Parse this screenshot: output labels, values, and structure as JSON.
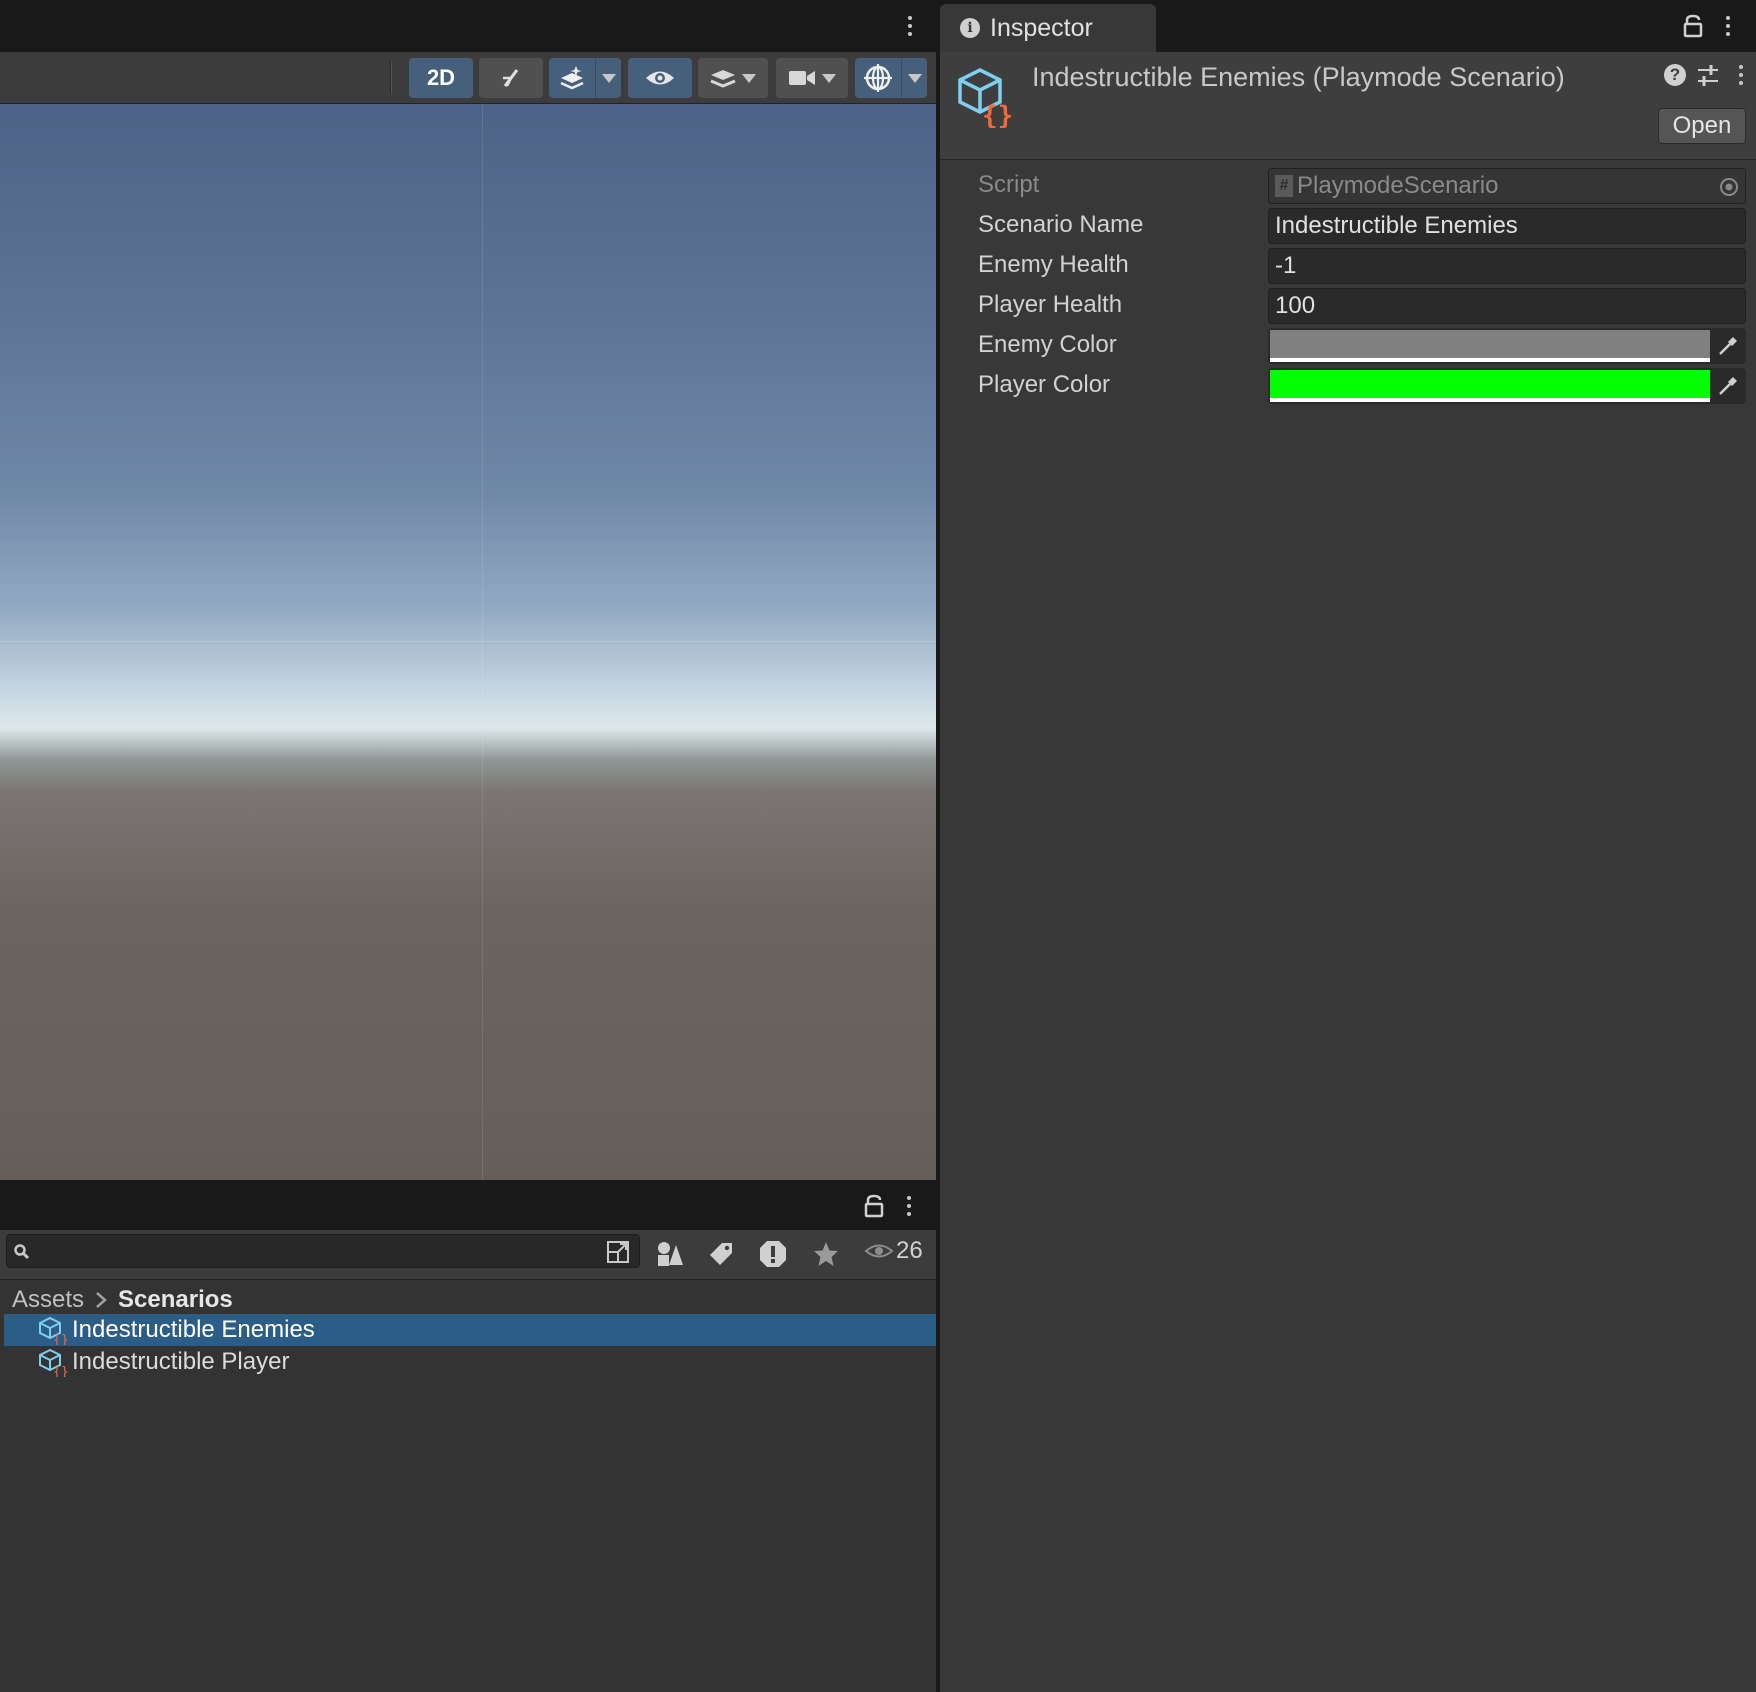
{
  "scene": {
    "toolbar": {
      "mode_2d_label": "2D",
      "icons": [
        "lighting-off-icon",
        "fx-layers-icon",
        "visibility-eye-icon",
        "layers-icon",
        "camera-icon",
        "gizmos-globe-icon"
      ]
    },
    "sky_color": "#5d7496",
    "ground_color": "#665e5a"
  },
  "project": {
    "search": {
      "placeholder": "",
      "value": ""
    },
    "hidden_count": "26",
    "breadcrumb": {
      "root": "Assets",
      "separator": ">",
      "current": "Scenarios"
    },
    "assets": [
      {
        "name": "Indestructible Enemies",
        "selected": true
      },
      {
        "name": "Indestructible Player",
        "selected": false
      }
    ],
    "selection_color": "#2c5d87"
  },
  "inspector": {
    "tab_label": "Inspector",
    "title": "Indestructible Enemies (Playmode Scenario)",
    "open_button": "Open",
    "properties": {
      "script": {
        "label": "Script",
        "value": "PlaymodeScenario"
      },
      "scenario_name": {
        "label": "Scenario Name",
        "value": "Indestructible Enemies"
      },
      "enemy_health": {
        "label": "Enemy Health",
        "value": "-1"
      },
      "player_health": {
        "label": "Player Health",
        "value": "100"
      },
      "enemy_color": {
        "label": "Enemy Color",
        "color": "#808080"
      },
      "player_color": {
        "label": "Player Color",
        "color": "#00ff00"
      }
    }
  }
}
